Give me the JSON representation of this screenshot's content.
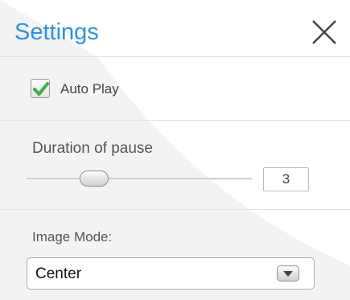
{
  "header": {
    "title": "Settings",
    "close_icon": "close-icon"
  },
  "autoplay": {
    "label": "Auto Play",
    "checked": true,
    "check_color": "#3cb043"
  },
  "duration": {
    "label": "Duration of pause",
    "value": "3",
    "slider_fraction": 0.3
  },
  "image_mode": {
    "label": "Image Mode:",
    "selected": "Center",
    "arrow_icon": "chevron-down-icon"
  },
  "colors": {
    "title": "#2a93e6",
    "divider": "#e1e1e1"
  }
}
